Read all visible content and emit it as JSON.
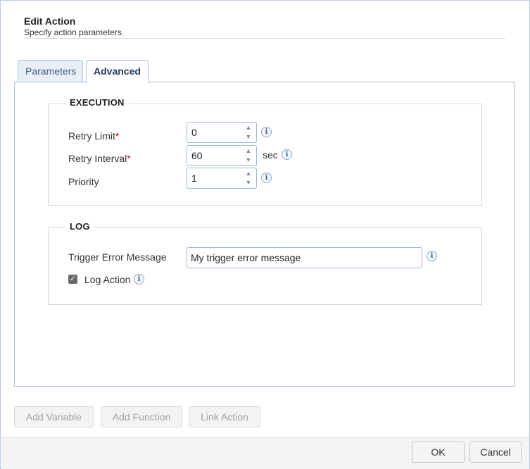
{
  "dialog": {
    "title": "Edit Action",
    "subtitle": "Specify action parameters."
  },
  "tabs": [
    {
      "label": "Parameters",
      "active": false
    },
    {
      "label": "Advanced",
      "active": true
    }
  ],
  "execution": {
    "legend": "EXECUTION",
    "retry_limit": {
      "label": "Retry Limit",
      "required_mark": "*",
      "value": "0"
    },
    "retry_interval": {
      "label": "Retry Interval",
      "required_mark": "*",
      "value": "60",
      "unit": "sec"
    },
    "priority": {
      "label": "Priority",
      "value": "1"
    }
  },
  "log": {
    "legend": "LOG",
    "trigger_error": {
      "label": "Trigger Error Message",
      "value": "My trigger error message"
    },
    "log_action": {
      "label": "Log Action",
      "checked": true
    }
  },
  "actions": {
    "add_variable": "Add Variable",
    "add_function": "Add Function",
    "link_action": "Link Action"
  },
  "footer": {
    "ok": "OK",
    "cancel": "Cancel"
  },
  "icons": {
    "info": "info-icon",
    "spin_up": "chevron-up-icon",
    "spin_down": "chevron-down-icon",
    "check": "checkmark-icon"
  },
  "colors": {
    "accent_border": "#a9bfd8",
    "required": "#d0021b",
    "tab_active_text": "#1f3c63"
  }
}
